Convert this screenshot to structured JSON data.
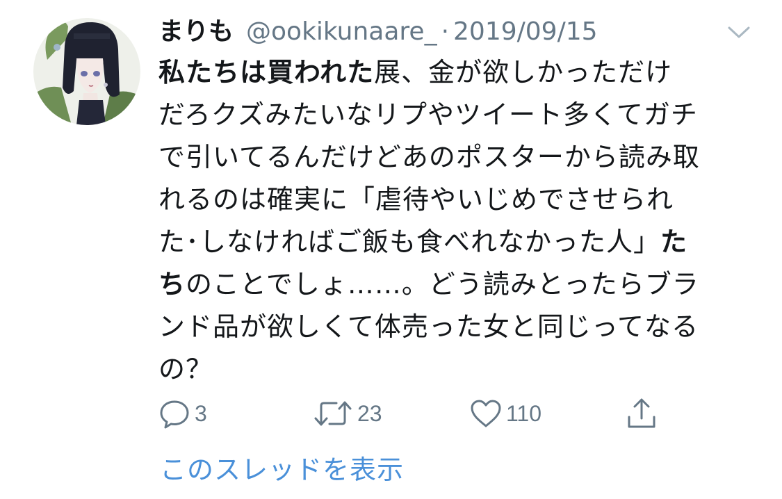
{
  "tweet": {
    "author_name": "まりも",
    "handle": "@ookikunaare_",
    "separator": "·",
    "date": "2019/09/15",
    "body": {
      "l1_bold": "私たちは買われた",
      "l1_rest": "展、金が欲しかっただけ",
      "l2": "だろクズみたいなリプやツイート多くてガチ",
      "l3": "で引いてるんだけどあのポスターから読み取",
      "l4": "れるのは確実に「虐待やいじめでさせられ",
      "l5_rest": "た･しなければご飯も食べれなかった人」",
      "l5_bold": "た",
      "l6_bold": "ち",
      "l6_rest": "のことでしょ……。どう読みとったらブラ",
      "l7": "ンド品が欲しくて体売った女と同じってなる",
      "l8": "の？"
    }
  },
  "actions": {
    "reply_count": "3",
    "retweet_count": "23",
    "like_count": "110"
  },
  "show_thread_label": "このスレッドを表示",
  "colors": {
    "text": "#14171a",
    "secondary": "#657786",
    "link": "#4a90d9"
  },
  "icons": [
    "avatar",
    "chevron-down-icon",
    "reply-icon",
    "retweet-icon",
    "like-icon",
    "share-icon"
  ]
}
